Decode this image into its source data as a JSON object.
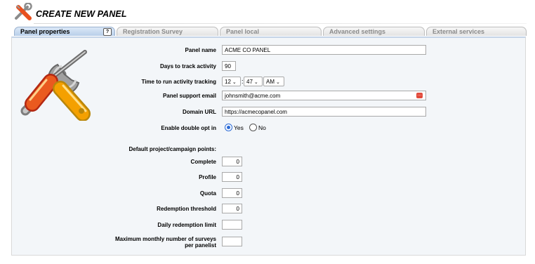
{
  "header": {
    "title": "CREATE NEW PANEL",
    "icon": "tools-icon"
  },
  "tabs": [
    {
      "label": "Panel properties",
      "active": true,
      "help": "?"
    },
    {
      "label": "Registration Survey",
      "active": false
    },
    {
      "label": "Panel local",
      "active": false
    },
    {
      "label": "Advanced settings",
      "active": false
    },
    {
      "label": "External services",
      "active": false
    }
  ],
  "form": {
    "panel_name": {
      "label": "Panel name",
      "value": "ACME CO PANEL"
    },
    "days_to_track": {
      "label": "Days to track activity",
      "value": "90"
    },
    "time_to_run": {
      "label": "Time to run activity tracking",
      "hour": "12",
      "minute": "47",
      "ampm": "AM",
      "separator": ":"
    },
    "support_email": {
      "label": "Panel support email",
      "value": "johnsmith@acme.com",
      "picker_icon": "ellipsis-icon"
    },
    "domain_url": {
      "label": "Domain URL",
      "value": "https://acmecopanel.com"
    },
    "double_opt_in": {
      "label": "Enable double opt in",
      "options": [
        "Yes",
        "No"
      ],
      "selected": "Yes"
    },
    "points_heading": "Default project/campaign points:",
    "complete": {
      "label": "Complete",
      "value": "0"
    },
    "profile": {
      "label": "Profile",
      "value": "0"
    },
    "quota": {
      "label": "Quota",
      "value": "0"
    },
    "redemption_threshold": {
      "label": "Redemption threshold",
      "value": "0"
    },
    "daily_redemption_limit": {
      "label": "Daily redemption limit",
      "value": ""
    },
    "max_monthly_surveys": {
      "label_line1": "Maximum monthly number of surveys",
      "label_line2": "per panelist",
      "value": ""
    }
  },
  "colors": {
    "active_tab": "#b8cfe9",
    "panel_background": "#f3f6f9",
    "radio_selected": "#2a6ad6",
    "picker_button": "#e24a3b"
  }
}
